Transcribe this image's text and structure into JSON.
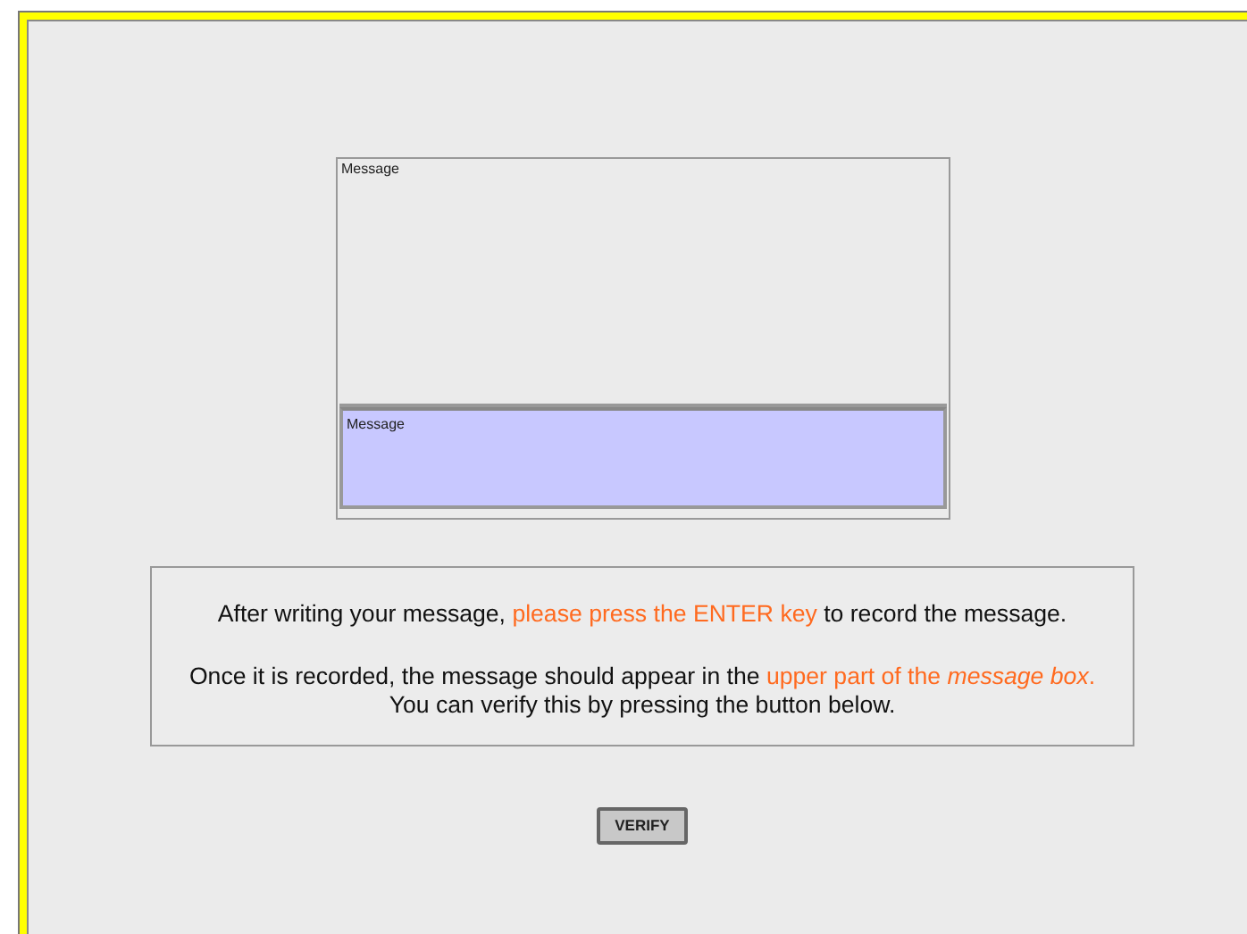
{
  "message_box": {
    "history": {
      "label": "Message"
    },
    "input": {
      "placeholder": "Message"
    }
  },
  "instructions": [
    {
      "segments": [
        {
          "text": "After writing your message, ",
          "highlight": false
        },
        {
          "text": "please press the ENTER key",
          "highlight": true
        },
        {
          "text": " to record the message.",
          "highlight": false
        }
      ]
    },
    {
      "segments": [
        {
          "text": "Once it is recorded, the message should appear in the ",
          "highlight": false
        },
        {
          "text": "upper part of the *message box*.",
          "highlight": true
        }
      ]
    },
    {
      "segments": [
        {
          "text": "You can verify this by pressing the button below.",
          "highlight": false
        }
      ]
    }
  ],
  "buttons": [
    "VERIFY"
  ]
}
